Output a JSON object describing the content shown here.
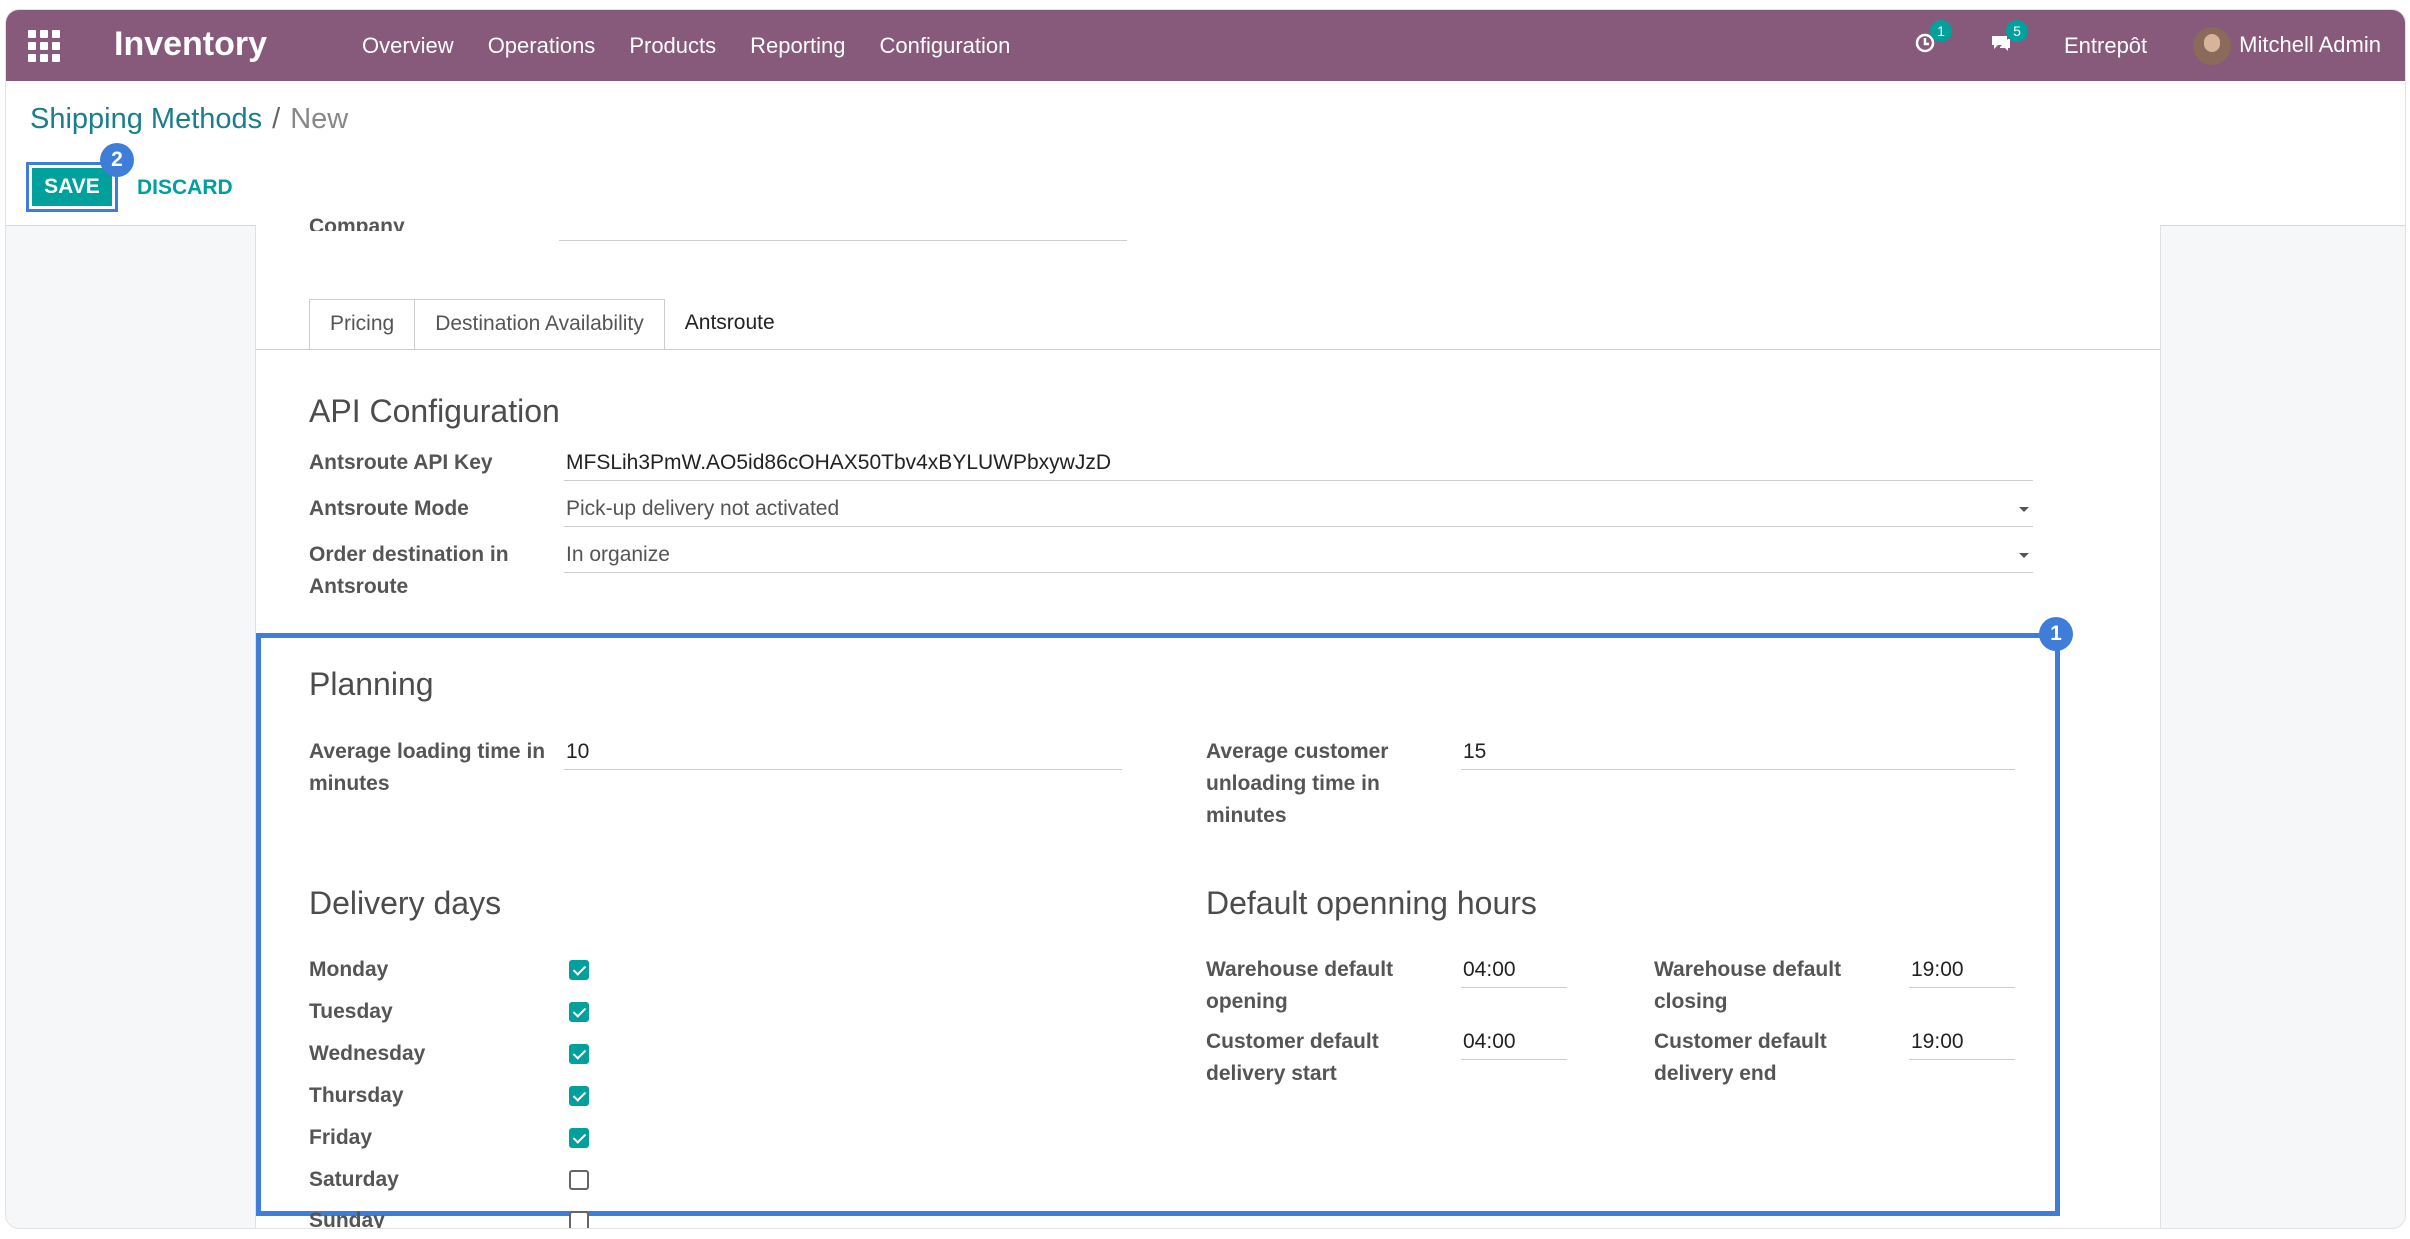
{
  "navbar": {
    "app_name": "Inventory",
    "menu": [
      "Overview",
      "Operations",
      "Products",
      "Reporting",
      "Configuration"
    ],
    "activity_count": "1",
    "messages_count": "5",
    "company": "Entrepôt",
    "user": "Mitchell Admin",
    "color": "#875a7b"
  },
  "breadcrumb": {
    "parent": "Shipping Methods",
    "separator": "/",
    "current": "New"
  },
  "buttons": {
    "save": "SAVE",
    "discard": "DISCARD"
  },
  "steps": {
    "save_step": "2",
    "section_step": "1"
  },
  "form": {
    "company_label": "Company",
    "tabs": [
      "Pricing",
      "Destination Availability",
      "Antsroute"
    ],
    "api": {
      "title": "API Configuration",
      "key_label": "Antsroute API Key",
      "key_value": "MFSLih3PmW.AO5id86cOHAX50Tbv4xBYLUWPbxywJzD",
      "mode_label": "Antsroute Mode",
      "mode_value": "Pick-up delivery not activated",
      "dest_label": "Order destination in Antsroute",
      "dest_value": "In organize"
    },
    "planning": {
      "title": "Planning",
      "loading_label": "Average loading time in minutes",
      "loading_value": "10",
      "unloading_label": "Average customer unloading time in minutes",
      "unloading_value": "15"
    },
    "delivery_days": {
      "title": "Delivery days",
      "days": [
        {
          "label": "Monday",
          "checked": true
        },
        {
          "label": "Tuesday",
          "checked": true
        },
        {
          "label": "Wednesday",
          "checked": true
        },
        {
          "label": "Thursday",
          "checked": true
        },
        {
          "label": "Friday",
          "checked": true
        },
        {
          "label": "Saturday",
          "checked": false
        },
        {
          "label": "Sunday",
          "checked": false
        }
      ]
    },
    "hours": {
      "title": "Default openning hours",
      "wh_open_label": "Warehouse default opening",
      "wh_open_value": "04:00",
      "wh_close_label": "Warehouse default closing",
      "wh_close_value": "19:00",
      "cust_start_label": "Customer default delivery start",
      "cust_start_value": "04:00",
      "cust_end_label": "Customer default delivery end",
      "cust_end_value": "19:00"
    }
  },
  "accent": "#00a09d",
  "highlight": "#3f7ed8"
}
